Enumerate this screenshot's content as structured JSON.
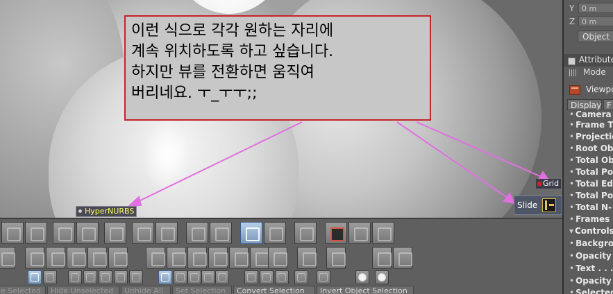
{
  "callout": {
    "lines": [
      "이런 식으로 각각 원하는 자리에",
      "계속 위치하도록 하고 싶습니다.",
      "하지만 뷰를 전환하면 움직여",
      "버리네요. ㅜ_ㅜㅜ;;"
    ]
  },
  "viewport_tags": {
    "hypernurbs": "HyperNURBS",
    "grid": "Grid",
    "slide": "Slide"
  },
  "bottom_buttons": [
    "e Selected",
    "Hide Unselected",
    "Unhide All",
    "Set Selection",
    "Convert Selection",
    "Invert Object Selection"
  ],
  "right_panel": {
    "coords": [
      {
        "axis": "Y",
        "value": "0 m"
      },
      {
        "axis": "Z",
        "value": "0 m"
      }
    ],
    "object_button": "Object",
    "attributes_title": "Attributes",
    "mode_label": "Mode",
    "viewport_label": "Viewpo",
    "tabs": [
      "Display",
      "F"
    ],
    "properties": [
      "Camera",
      "Frame T",
      "Projectio",
      "Root Obj",
      "Total Ob",
      "Total Po",
      "Total Ed",
      "Total Po",
      "Total N-",
      "Frames (",
      "Controls",
      "Backgrou",
      "Opacity",
      "Text . . . .",
      "Opacity",
      "Selected"
    ]
  },
  "colors": {
    "callout_border": "#c4232a",
    "arrow": "#e070e0",
    "hypernurbs_text": "#ffff66",
    "grid_marker": "#d02020"
  },
  "icons": {
    "toolbar_row1": [
      "cube-icon",
      "cube-wire-icon",
      "deformer-icon",
      "floor-icon",
      "camera-icon",
      "array-icon",
      "array-wire-icon",
      "knife-icon",
      "magnet-icon",
      "edge-slide-icon",
      "bevel-icon",
      "bridge-icon",
      "render-icon",
      "sphere-icon",
      "grid-icon"
    ],
    "toolbar_row2": [
      "extrude-icon",
      "extrude-inner-icon",
      "weld-icon",
      "split-icon",
      "subdivide-icon",
      "mirror-icon",
      "brush-icon",
      "align-icon",
      "triangulate-icon",
      "untriangulate-icon",
      "optimize-icon",
      "melt-icon",
      "dissolve-icon",
      "arrange-icon",
      "axis-icon",
      "help-icon",
      "help2-icon"
    ],
    "toolbar_row3": [
      "live-select-icon",
      "rect-select-icon",
      "loop-select-icon",
      "ring-select-icon",
      "fill-select-icon",
      "phong-icon",
      "grow-icon",
      "shrink-icon",
      "layout-icon",
      "layout2-icon",
      "layout3-icon",
      "layout4-icon",
      "layout5-icon",
      "hide-icon",
      "reveal-icon",
      "lock-icon",
      "swap-icon",
      "sphere-icon",
      "dot-icon"
    ]
  }
}
